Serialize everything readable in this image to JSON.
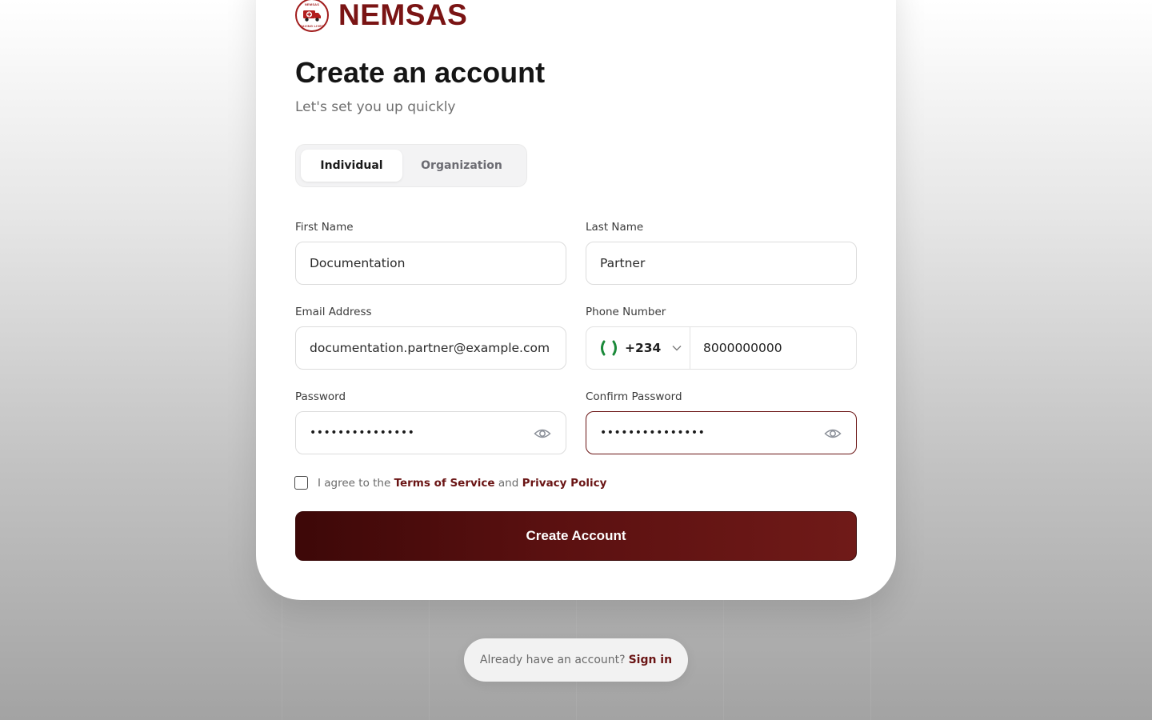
{
  "brand": {
    "name": "NEMSAS",
    "logo_top_text": "NEMSAS",
    "logo_bottom_text": "SAVING LIVES",
    "color": "#7a1414"
  },
  "form": {
    "title": "Create an account",
    "subtitle": "Let's set you up quickly",
    "account_types": [
      "Individual",
      "Organization"
    ],
    "selected_account_type": "Individual",
    "first_name": {
      "label": "First Name",
      "value": "Documentation"
    },
    "last_name": {
      "label": "Last Name",
      "value": "Partner"
    },
    "email": {
      "label": "Email Address",
      "value": "documentation.partner@example.com"
    },
    "phone": {
      "label": "Phone Number",
      "country_code": "+234",
      "value": "8000000000",
      "flag": "nigeria-flag-icon"
    },
    "password": {
      "label": "Password",
      "value": "•••••••••••••••"
    },
    "confirm_password": {
      "label": "Confirm Password",
      "value": "•••••••••••••••"
    },
    "terms": {
      "prefix": "I agree to the",
      "tos": "Terms of Service",
      "and": "and",
      "privacy": "Privacy Policy"
    },
    "submit_label": "Create Account"
  },
  "footer": {
    "prompt": "Already have an account?",
    "signin_label": "Sign in"
  },
  "colors": {
    "accent": "#6a1414",
    "button_gradient_start": "#3d0808",
    "button_gradient_end": "#701a18"
  }
}
